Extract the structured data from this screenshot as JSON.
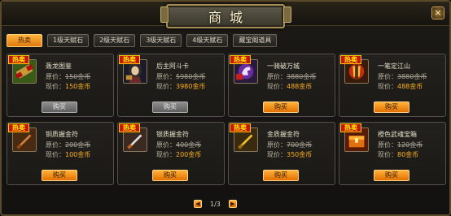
{
  "header": {
    "title": "商城",
    "close_label": "×"
  },
  "tabs": [
    {
      "label": "热卖",
      "active": true
    },
    {
      "label": "1级天赋石",
      "active": false
    },
    {
      "label": "2级天赋石",
      "active": false
    },
    {
      "label": "3级天赋石",
      "active": false
    },
    {
      "label": "4级天赋石",
      "active": false
    },
    {
      "label": "藏宝阁道具",
      "active": false
    }
  ],
  "labels": {
    "hot": "热卖",
    "original_price": "原价：",
    "current_price": "现价：",
    "buy": "购买"
  },
  "items": [
    {
      "name": "轰龙图鉴",
      "orig": "150金币",
      "now": "150金币",
      "hot": true,
      "buy_enabled": false,
      "icon": "scroll-icon"
    },
    {
      "name": "后主阿斗卡",
      "orig": "5980金币",
      "now": "3980金币",
      "hot": true,
      "buy_enabled": false,
      "icon": "warrior-portrait-icon"
    },
    {
      "name": "一骑破万城",
      "orig": "3880金币",
      "now": "488金币",
      "hot": true,
      "buy_enabled": true,
      "icon": "horse-emblem-icon"
    },
    {
      "name": "一笔定江山",
      "orig": "3880金币",
      "now": "488金币",
      "hot": true,
      "buy_enabled": true,
      "icon": "brush-emblem-icon"
    },
    {
      "name": "铜质握金符",
      "orig": "200金币",
      "now": "100金币",
      "hot": true,
      "buy_enabled": true,
      "icon": "bronze-dagger-icon"
    },
    {
      "name": "银质握金符",
      "orig": "400金币",
      "now": "200金币",
      "hot": true,
      "buy_enabled": true,
      "icon": "silver-dagger-icon"
    },
    {
      "name": "金质握金符",
      "orig": "700金币",
      "now": "350金币",
      "hot": true,
      "buy_enabled": true,
      "icon": "gold-dagger-icon"
    },
    {
      "name": "橙色武魂宝箱",
      "orig": "120金币",
      "now": "80金币",
      "hot": true,
      "buy_enabled": true,
      "icon": "treasure-chest-icon"
    }
  ],
  "pager": {
    "prev": "◀",
    "next": "▶",
    "text": "1/3"
  },
  "colors": {
    "accent": "#f29a1a",
    "hot_badge": "#c8140e",
    "price_now": "#ffb020"
  }
}
